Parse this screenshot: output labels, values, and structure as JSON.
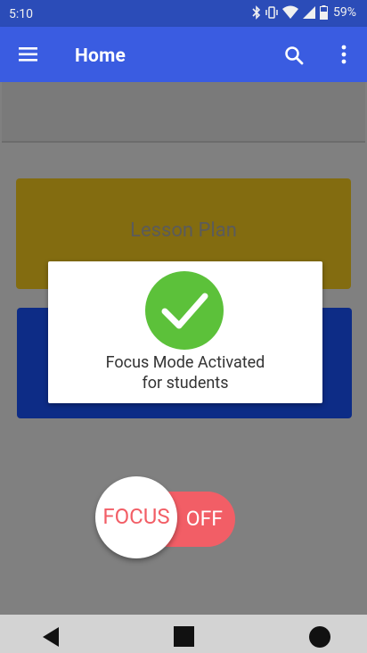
{
  "status_bar": {
    "time": "5:10",
    "battery_text": "59%",
    "icons": [
      "bluetooth-icon",
      "vibrate-icon",
      "wifi-icon",
      "signal-icon",
      "battery-icon"
    ]
  },
  "app_bar": {
    "title": "Home",
    "icons": [
      "menu-icon",
      "search-icon",
      "more-vertical-icon"
    ]
  },
  "cards": {
    "lesson_plan": "Lesson Plan"
  },
  "dialog": {
    "icon": "check-circle-icon",
    "line1": "Focus Mode Activated",
    "line2": "for students"
  },
  "toggle": {
    "knob_label": "FOCUS",
    "state_label": "OFF"
  },
  "nav_bar": {
    "icons": [
      "back-icon",
      "home-icon",
      "recents-icon"
    ]
  },
  "colors": {
    "status_bar": "#2b4cb8",
    "app_bar": "#3a5ce1",
    "lesson_card": "#836c10",
    "blue_card": "#0d2c86",
    "check_green": "#5cc13a",
    "toggle_red": "#f25e66"
  }
}
